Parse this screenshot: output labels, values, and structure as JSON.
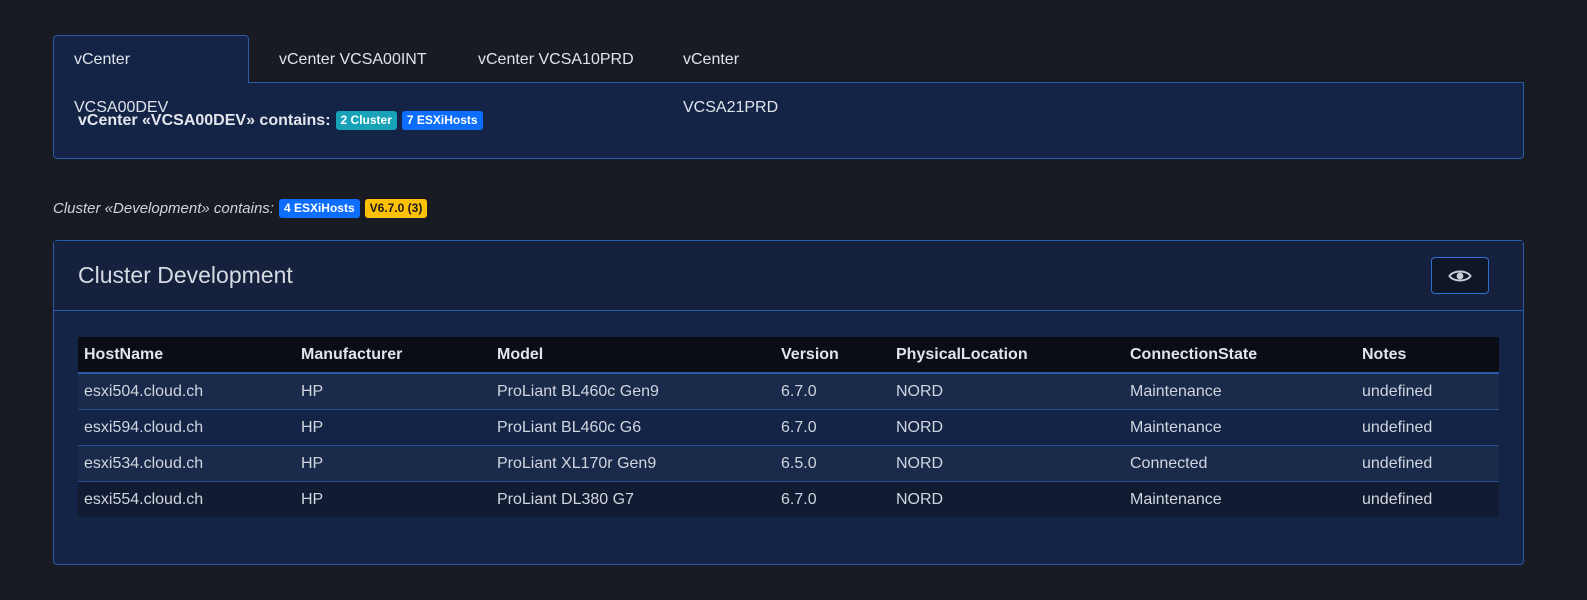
{
  "tabs": [
    {
      "label": "vCenter VCSA00DEV",
      "active": true
    },
    {
      "label": "vCenter VCSA00INT",
      "active": false
    },
    {
      "label": "vCenter VCSA10PRD",
      "active": false
    },
    {
      "label": "vCenter VCSA21PRD",
      "active": false
    }
  ],
  "summary": {
    "text": "vCenter «VCSA00DEV» contains:",
    "cluster_badge": "2 Cluster",
    "hosts_badge": "7 ESXiHosts"
  },
  "cluster_line": {
    "text": "Cluster «Development» contains:",
    "hosts_badge": "4 ESXiHosts",
    "version_badge": "V6.7.0 (3)"
  },
  "card": {
    "title": "Cluster Development",
    "view_icon": "eye-icon"
  },
  "table": {
    "headers": [
      "HostName",
      "Manufacturer",
      "Model",
      "Version",
      "PhysicalLocation",
      "ConnectionState",
      "Notes"
    ],
    "rows": [
      [
        "esxi504.cloud.ch",
        "HP",
        "ProLiant BL460c Gen9",
        "6.7.0",
        "NORD",
        "Maintenance",
        "undefined"
      ],
      [
        "esxi594.cloud.ch",
        "HP",
        "ProLiant BL460c G6",
        "6.7.0",
        "NORD",
        "Maintenance",
        "undefined"
      ],
      [
        "esxi534.cloud.ch",
        "HP",
        "ProLiant XL170r Gen9",
        "6.5.0",
        "NORD",
        "Connected",
        "undefined"
      ],
      [
        "esxi554.cloud.ch",
        "HP",
        "ProLiant DL380 G7",
        "6.7.0",
        "NORD",
        "Maintenance",
        "undefined"
      ]
    ]
  },
  "colors": {
    "background": "#181b22",
    "panel": "#142446",
    "border": "#2a5aa8",
    "badge_teal": "#17a2b8",
    "badge_blue": "#0d6efd",
    "badge_yellow": "#ffc107"
  }
}
